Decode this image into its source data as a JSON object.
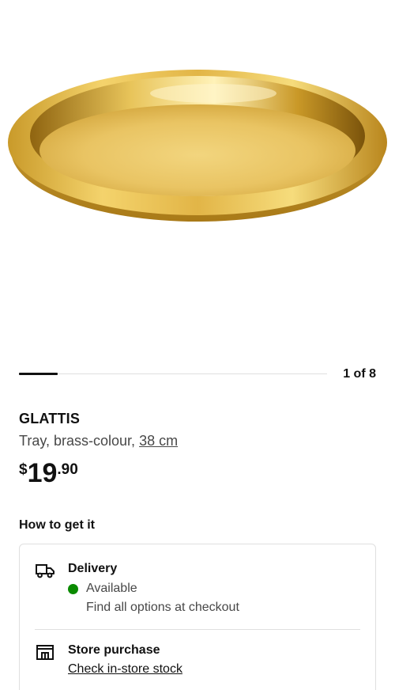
{
  "product": {
    "name": "GLATTIS",
    "description": "Tray, brass-colour,",
    "size": "38 cm",
    "price": {
      "currency": "$",
      "integer": "19",
      "decimal": ".90"
    }
  },
  "gallery": {
    "counter": "1 of 8",
    "progress_fraction": 0.125,
    "image_icon": "brass-tray-image"
  },
  "availability": {
    "section_title": "How to get it",
    "delivery": {
      "icon": "delivery-truck-icon",
      "title": "Delivery",
      "status": "Available",
      "status_color": "#0a8a00",
      "note": "Find all options at checkout"
    },
    "store": {
      "icon": "store-icon",
      "title": "Store purchase",
      "link": "Check in-store stock"
    }
  }
}
